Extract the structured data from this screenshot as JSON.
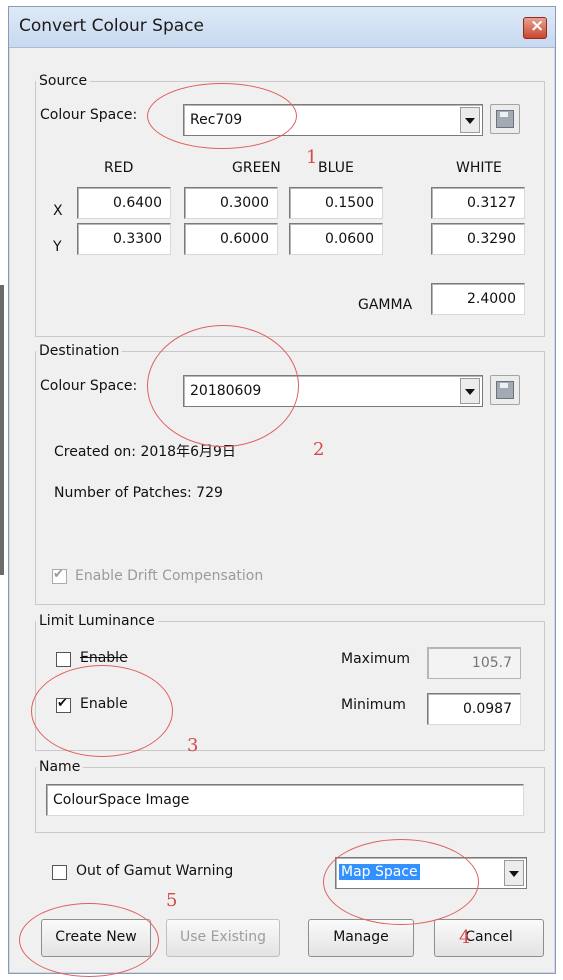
{
  "window": {
    "title": "Convert Colour Space"
  },
  "source": {
    "legend": "Source",
    "colour_space_label": "Colour Space:",
    "colour_space_value": "Rec709",
    "headers": {
      "red": "RED",
      "green": "GREEN",
      "blue": "BLUE",
      "white": "WHITE"
    },
    "row_labels": {
      "x": "X",
      "y": "Y"
    },
    "x": {
      "red": "0.6400",
      "green": "0.3000",
      "blue": "0.1500",
      "white": "0.3127"
    },
    "y": {
      "red": "0.3300",
      "green": "0.6000",
      "blue": "0.0600",
      "white": "0.3290"
    },
    "gamma_label": "GAMMA",
    "gamma_value": "2.4000"
  },
  "destination": {
    "legend": "Destination",
    "colour_space_label": "Colour Space:",
    "colour_space_value": "20180609",
    "created_on": "Created on: 2018年6月9日",
    "patches": "Number of Patches: 729",
    "drift_label": "Enable Drift Compensation",
    "drift_checked": true
  },
  "limit_luminance": {
    "legend": "Limit Luminance",
    "enable1_label": "Enable",
    "enable1_checked": false,
    "enable2_label": "Enable",
    "enable2_checked": true,
    "maximum_label": "Maximum",
    "maximum_value": "105.7",
    "minimum_label": "Minimum",
    "minimum_value": "0.0987"
  },
  "name": {
    "legend": "Name",
    "value": "ColourSpace Image"
  },
  "out_of_gamut": {
    "label": "Out of Gamut Warning",
    "checked": false
  },
  "map_select": {
    "value": "Map Space"
  },
  "buttons": {
    "create_new": "Create New",
    "use_existing": "Use Existing",
    "manage": "Manage",
    "cancel": "Cancel"
  },
  "annotations": {
    "m1": "1",
    "m2": "2",
    "m3": "3",
    "m4": "4",
    "m5": "5",
    "color": "#e06060"
  }
}
